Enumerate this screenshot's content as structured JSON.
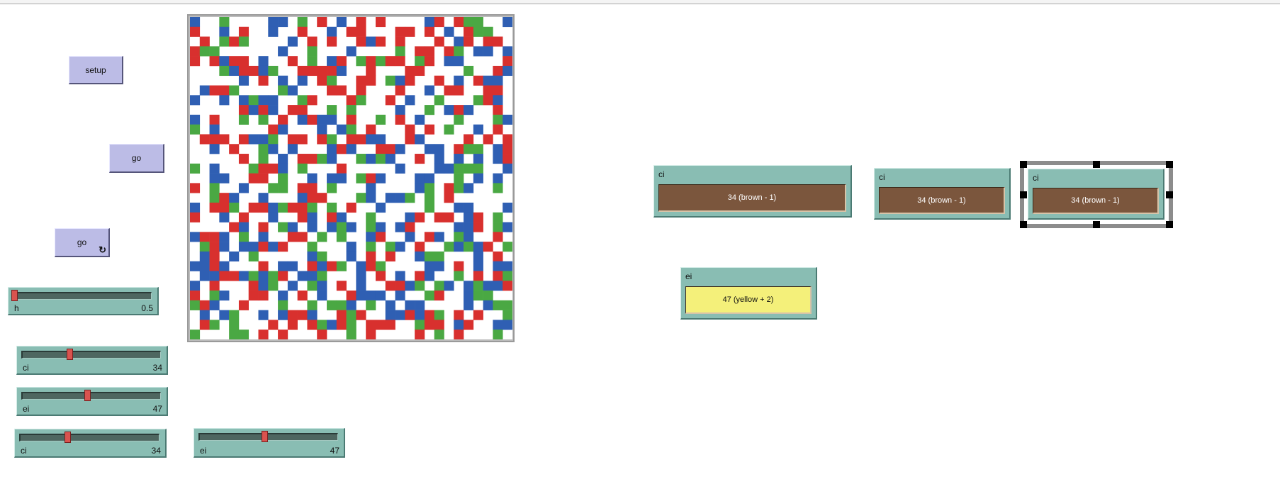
{
  "buttons": {
    "setup": {
      "label": "setup"
    },
    "go_once": {
      "label": "go"
    },
    "go_forever": {
      "label": "go",
      "icon": "forever-loop-icon"
    }
  },
  "sliders": [
    {
      "id": "h",
      "name": "h",
      "value": "0.5",
      "position": 0.0
    },
    {
      "id": "ci1",
      "name": "ci",
      "value": "34",
      "position": 0.34
    },
    {
      "id": "ei1",
      "name": "ei",
      "value": "47",
      "position": 0.47
    },
    {
      "id": "ci2",
      "name": "ci",
      "value": "34",
      "position": 0.34
    },
    {
      "id": "ei2",
      "name": "ei",
      "value": "47",
      "position": 0.47
    }
  ],
  "choosers": [
    {
      "id": "ci_a",
      "label": "ci",
      "value": "34 (brown - 1)",
      "swatch": "#7b563d",
      "text_color": "#ffffff"
    },
    {
      "id": "ci_b",
      "label": "ci",
      "value": "34 (brown - 1)",
      "swatch": "#7b563d",
      "text_color": "#ffffff"
    },
    {
      "id": "ci_c",
      "label": "ci",
      "value": "34 (brown - 1)",
      "swatch": "#7b563d",
      "text_color": "#ffffff",
      "selected": true
    },
    {
      "id": "ei_a",
      "label": "ei",
      "value": "47 (yellow + 2)",
      "swatch": "#f4f07a",
      "text_color": "#111111"
    }
  ],
  "world": {
    "cols": 33,
    "rows": 33,
    "palette": {
      "R": "#d8302e",
      "B": "#2f5fb3",
      "G": "#4aa843",
      "W": "#ffffff"
    },
    "patches": [
      "BWWGWWWWBBWGWRWBWRWRWWWWBRWRGGWWB",
      "RWWBWRWWBWWRWWBWRRWWWRRWRWBWRGGWW",
      "WRWGRGWWWWBWRWRWWRBRWRWWWRWBRWRRW",
      "RGGWWWWWWBWWGWWWBWWWWGWRRWRGWBBWB",
      "RWRBRRWBWWRWGWBRWGRGRRWGRWBBWWWWR",
      "WWWGBRRBGWWRRRRBWWRWWWRRWWWWGWWRB",
      "WWWWWBWRWBWBWRGWWRRWGBRWWRWBWRBBW",
      "WBRRGWWWWGBWWWRRWRWWWRWWBWRRWWRRW",
      "BWWBWBGBBWWGRWWWRGWWRWBWWGWWWGRBW",
      "WWWWWRBRBWRRWWGWGWWWWBWWGWBRBWWRW",
      "BWRWWGWGWRWBRBBWRWWGWRWBWWWGWWWGB",
      "GWBWWWWWRBWWWBWBGWRWWWRWRWGWWBWRW",
      "WRRRWRBBGWRRWRGWRRBBWWRBWWWWRWRWR",
      "WWBWRWWGBWBWWWBRBWWRRBWWBBWRGGWBR",
      "WWWWWRWGWBWRRGBWWGBGBWWRWBWBWBWBR",
      "GWBWWWGRRBWGWWWRWWWWWBWWWBBGGGWWB",
      "WWBBWWRRWGWWBWBBWGRBWWWBBWWGWBWBW",
      "RWGWWBWWGGWRRWGWWWBWWWWBGWRGBWWGW",
      "WWGRBWWBWWWBRRWWWGBWBBGWGWRWWWWWW",
      "BWRRGWRRBGRRGWGWRWWBWWWWGWWBBWWWB",
      "RWWBWRWWBWWRBWRBWWGWWWBRWRRWBRWGW",
      "WWWWRBWRWGBWBWBGBWGBWBRWWWWBBRWGB",
      "BRRBWGWBWWRRWGWGWWBRWWBWRBWGBWWRW",
      "WGRBWBBRBRWWGWWWBWGWGBWRWWGBGBRWG",
      "WBRWBWGWWWWWBGWWBWRWRWWBGGWWWBWRW",
      "BBRBWWWRWBBWRBRGWBRGWWWWBBWRWBWBB",
      "WBBRRBGBGRWBBGWWWBWRWBWRBWWGWRWRG",
      "BWRWWWRBGWBWGBWRWBWWRRBGWGBWBGBBR",
      "RWGBWWRRWBWRWBWWRBBBWBWWGRWWBGGWW",
      "GRBWWRWWWGWWGWGGBWGWBWBBWWWWBWBGG",
      "WBWBGWWBWBRRBWWRGRWWBBRBRGWRWRWWG",
      "WRGWGWWWRWRWRGBRGWRRRWWGRRWBRWWBB",
      "GWWWGGWRWRWWWRWWGWRWWWWRWGWRWWWGW"
    ]
  }
}
